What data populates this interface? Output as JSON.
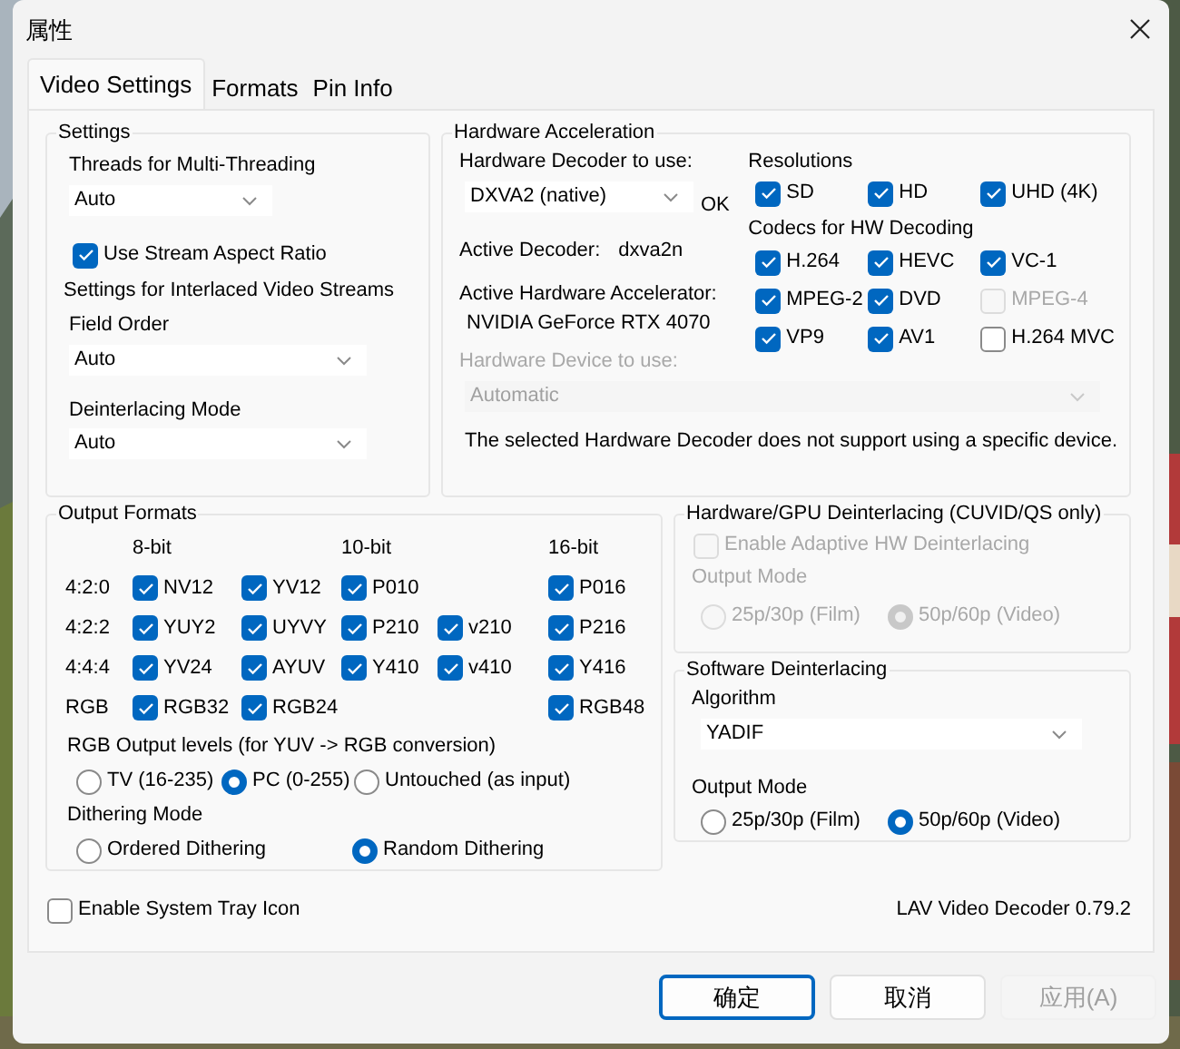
{
  "window": {
    "title": "属性"
  },
  "tabs": [
    {
      "label": "Video Settings",
      "selected": true
    },
    {
      "label": "Formats",
      "selected": false
    },
    {
      "label": "Pin Info",
      "selected": false
    }
  ],
  "settings": {
    "title": "Settings",
    "threads": {
      "label": "Threads for Multi-Threading",
      "value": "Auto"
    },
    "aspect_ratio": {
      "label": "Use Stream Aspect Ratio",
      "checked": true
    },
    "interlaced_title": "Settings for Interlaced Video Streams",
    "field_order": {
      "label": "Field Order",
      "value": "Auto"
    },
    "deinterlacing_mode": {
      "label": "Deinterlacing Mode",
      "value": "Auto"
    }
  },
  "hardware_acceleration": {
    "title": "Hardware Acceleration",
    "decoder": {
      "label": "Hardware Decoder to use:",
      "value": "DXVA2 (native)",
      "status": "OK"
    },
    "active_decoder": {
      "label": "Active Decoder:",
      "value": "dxva2n"
    },
    "active_accelerator": {
      "label": "Active Hardware Accelerator:",
      "value": "NVIDIA GeForce RTX 4070"
    },
    "device": {
      "label": "Hardware Device to use:",
      "value": "Automatic",
      "disabled": true
    },
    "note": "The selected Hardware Decoder does not support using a specific device.",
    "resolutions": {
      "title": "Resolutions",
      "items": [
        {
          "label": "SD",
          "checked": true,
          "disabled": false
        },
        {
          "label": "HD",
          "checked": true,
          "disabled": false
        },
        {
          "label": "UHD (4K)",
          "checked": true,
          "disabled": false
        }
      ]
    },
    "codecs": {
      "title": "Codecs for HW Decoding",
      "items": [
        {
          "label": "H.264",
          "checked": true,
          "disabled": false
        },
        {
          "label": "HEVC",
          "checked": true,
          "disabled": false
        },
        {
          "label": "VC-1",
          "checked": true,
          "disabled": false
        },
        {
          "label": "MPEG-2",
          "checked": true,
          "disabled": false
        },
        {
          "label": "DVD",
          "checked": true,
          "disabled": false
        },
        {
          "label": "MPEG-4",
          "checked": false,
          "disabled": true
        },
        {
          "label": "VP9",
          "checked": true,
          "disabled": false
        },
        {
          "label": "AV1",
          "checked": true,
          "disabled": false
        },
        {
          "label": "H.264 MVC",
          "checked": false,
          "disabled": false
        }
      ]
    }
  },
  "output_formats": {
    "title": "Output Formats",
    "bit_depths": [
      {
        "kind": "label",
        "label": "8-bit"
      },
      {
        "kind": "empty"
      },
      {
        "kind": "label",
        "label": "10-bit"
      },
      {
        "kind": "empty"
      },
      {
        "kind": "label",
        "label": "16-bit"
      }
    ],
    "rows": [
      {
        "label": "4:2:0",
        "formats": [
          {
            "label": "NV12",
            "checked": true
          },
          {
            "label": "YV12",
            "checked": true
          },
          {
            "label": "P010",
            "checked": true
          },
          {
            "kind": "empty"
          },
          {
            "label": "P016",
            "checked": true
          }
        ]
      },
      {
        "label": "4:2:2",
        "formats": [
          {
            "label": "YUY2",
            "checked": true
          },
          {
            "label": "UYVY",
            "checked": true
          },
          {
            "label": "P210",
            "checked": true
          },
          {
            "label": "v210",
            "checked": true
          },
          {
            "label": "P216",
            "checked": true
          }
        ]
      },
      {
        "label": "4:4:4",
        "formats": [
          {
            "label": "YV24",
            "checked": true
          },
          {
            "label": "AYUV",
            "checked": true
          },
          {
            "label": "Y410",
            "checked": true
          },
          {
            "label": "v410",
            "checked": true
          },
          {
            "label": "Y416",
            "checked": true
          }
        ]
      },
      {
        "label": "RGB",
        "formats": [
          {
            "label": "RGB32",
            "checked": true
          },
          {
            "label": "RGB24",
            "checked": true
          },
          {
            "kind": "empty"
          },
          {
            "kind": "empty"
          },
          {
            "label": "RGB48",
            "checked": true
          }
        ]
      }
    ],
    "rgb_levels": {
      "label": "RGB Output levels (for YUV -> RGB conversion)",
      "options": [
        {
          "label": "TV (16-235)",
          "selected": false
        },
        {
          "label": "PC (0-255)",
          "selected": true
        },
        {
          "label": "Untouched (as input)",
          "selected": false
        }
      ]
    },
    "dithering": {
      "label": "Dithering Mode",
      "options": [
        {
          "label": "Ordered Dithering",
          "selected": false
        },
        {
          "label": "Random Dithering",
          "selected": true
        }
      ]
    }
  },
  "hw_deinterlacing": {
    "title": "Hardware/GPU Deinterlacing (CUVID/QS only)",
    "adaptive": {
      "label": "Enable Adaptive HW Deinterlacing",
      "checked": false,
      "disabled": true
    },
    "output_mode": {
      "label": "Output Mode",
      "disabled": true,
      "options": [
        {
          "label": "25p/30p (Film)",
          "selected": false
        },
        {
          "label": "50p/60p (Video)",
          "selected": true
        }
      ]
    }
  },
  "sw_deinterlacing": {
    "title": "Software Deinterlacing",
    "algorithm": {
      "label": "Algorithm",
      "value": "YADIF"
    },
    "output_mode": {
      "label": "Output Mode",
      "disabled": false,
      "options": [
        {
          "label": "25p/30p (Film)",
          "selected": false
        },
        {
          "label": "50p/60p (Video)",
          "selected": true
        }
      ]
    }
  },
  "tray_icon": {
    "label": "Enable System Tray Icon",
    "checked": false
  },
  "version": "LAV Video Decoder 0.79.2",
  "buttons": [
    {
      "label": "确定",
      "focused": true,
      "disabled": false
    },
    {
      "label": "取消",
      "focused": false,
      "disabled": false
    },
    {
      "label": "应用(A)",
      "focused": false,
      "disabled": true
    }
  ]
}
